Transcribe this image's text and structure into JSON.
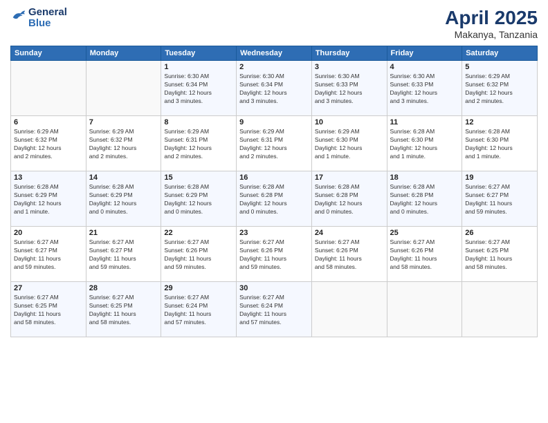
{
  "header": {
    "logo": {
      "general": "General",
      "blue": "Blue"
    },
    "title": "April 2025",
    "subtitle": "Makanya, Tanzania"
  },
  "calendar": {
    "weekdays": [
      "Sunday",
      "Monday",
      "Tuesday",
      "Wednesday",
      "Thursday",
      "Friday",
      "Saturday"
    ],
    "weeks": [
      [
        {
          "day": "",
          "info": ""
        },
        {
          "day": "",
          "info": ""
        },
        {
          "day": "1",
          "info": "Sunrise: 6:30 AM\nSunset: 6:34 PM\nDaylight: 12 hours\nand 3 minutes."
        },
        {
          "day": "2",
          "info": "Sunrise: 6:30 AM\nSunset: 6:34 PM\nDaylight: 12 hours\nand 3 minutes."
        },
        {
          "day": "3",
          "info": "Sunrise: 6:30 AM\nSunset: 6:33 PM\nDaylight: 12 hours\nand 3 minutes."
        },
        {
          "day": "4",
          "info": "Sunrise: 6:30 AM\nSunset: 6:33 PM\nDaylight: 12 hours\nand 3 minutes."
        },
        {
          "day": "5",
          "info": "Sunrise: 6:29 AM\nSunset: 6:32 PM\nDaylight: 12 hours\nand 2 minutes."
        }
      ],
      [
        {
          "day": "6",
          "info": "Sunrise: 6:29 AM\nSunset: 6:32 PM\nDaylight: 12 hours\nand 2 minutes."
        },
        {
          "day": "7",
          "info": "Sunrise: 6:29 AM\nSunset: 6:32 PM\nDaylight: 12 hours\nand 2 minutes."
        },
        {
          "day": "8",
          "info": "Sunrise: 6:29 AM\nSunset: 6:31 PM\nDaylight: 12 hours\nand 2 minutes."
        },
        {
          "day": "9",
          "info": "Sunrise: 6:29 AM\nSunset: 6:31 PM\nDaylight: 12 hours\nand 2 minutes."
        },
        {
          "day": "10",
          "info": "Sunrise: 6:29 AM\nSunset: 6:30 PM\nDaylight: 12 hours\nand 1 minute."
        },
        {
          "day": "11",
          "info": "Sunrise: 6:28 AM\nSunset: 6:30 PM\nDaylight: 12 hours\nand 1 minute."
        },
        {
          "day": "12",
          "info": "Sunrise: 6:28 AM\nSunset: 6:30 PM\nDaylight: 12 hours\nand 1 minute."
        }
      ],
      [
        {
          "day": "13",
          "info": "Sunrise: 6:28 AM\nSunset: 6:29 PM\nDaylight: 12 hours\nand 1 minute."
        },
        {
          "day": "14",
          "info": "Sunrise: 6:28 AM\nSunset: 6:29 PM\nDaylight: 12 hours\nand 0 minutes."
        },
        {
          "day": "15",
          "info": "Sunrise: 6:28 AM\nSunset: 6:29 PM\nDaylight: 12 hours\nand 0 minutes."
        },
        {
          "day": "16",
          "info": "Sunrise: 6:28 AM\nSunset: 6:28 PM\nDaylight: 12 hours\nand 0 minutes."
        },
        {
          "day": "17",
          "info": "Sunrise: 6:28 AM\nSunset: 6:28 PM\nDaylight: 12 hours\nand 0 minutes."
        },
        {
          "day": "18",
          "info": "Sunrise: 6:28 AM\nSunset: 6:28 PM\nDaylight: 12 hours\nand 0 minutes."
        },
        {
          "day": "19",
          "info": "Sunrise: 6:27 AM\nSunset: 6:27 PM\nDaylight: 11 hours\nand 59 minutes."
        }
      ],
      [
        {
          "day": "20",
          "info": "Sunrise: 6:27 AM\nSunset: 6:27 PM\nDaylight: 11 hours\nand 59 minutes."
        },
        {
          "day": "21",
          "info": "Sunrise: 6:27 AM\nSunset: 6:27 PM\nDaylight: 11 hours\nand 59 minutes."
        },
        {
          "day": "22",
          "info": "Sunrise: 6:27 AM\nSunset: 6:26 PM\nDaylight: 11 hours\nand 59 minutes."
        },
        {
          "day": "23",
          "info": "Sunrise: 6:27 AM\nSunset: 6:26 PM\nDaylight: 11 hours\nand 59 minutes."
        },
        {
          "day": "24",
          "info": "Sunrise: 6:27 AM\nSunset: 6:26 PM\nDaylight: 11 hours\nand 58 minutes."
        },
        {
          "day": "25",
          "info": "Sunrise: 6:27 AM\nSunset: 6:26 PM\nDaylight: 11 hours\nand 58 minutes."
        },
        {
          "day": "26",
          "info": "Sunrise: 6:27 AM\nSunset: 6:25 PM\nDaylight: 11 hours\nand 58 minutes."
        }
      ],
      [
        {
          "day": "27",
          "info": "Sunrise: 6:27 AM\nSunset: 6:25 PM\nDaylight: 11 hours\nand 58 minutes."
        },
        {
          "day": "28",
          "info": "Sunrise: 6:27 AM\nSunset: 6:25 PM\nDaylight: 11 hours\nand 58 minutes."
        },
        {
          "day": "29",
          "info": "Sunrise: 6:27 AM\nSunset: 6:24 PM\nDaylight: 11 hours\nand 57 minutes."
        },
        {
          "day": "30",
          "info": "Sunrise: 6:27 AM\nSunset: 6:24 PM\nDaylight: 11 hours\nand 57 minutes."
        },
        {
          "day": "",
          "info": ""
        },
        {
          "day": "",
          "info": ""
        },
        {
          "day": "",
          "info": ""
        }
      ]
    ]
  }
}
